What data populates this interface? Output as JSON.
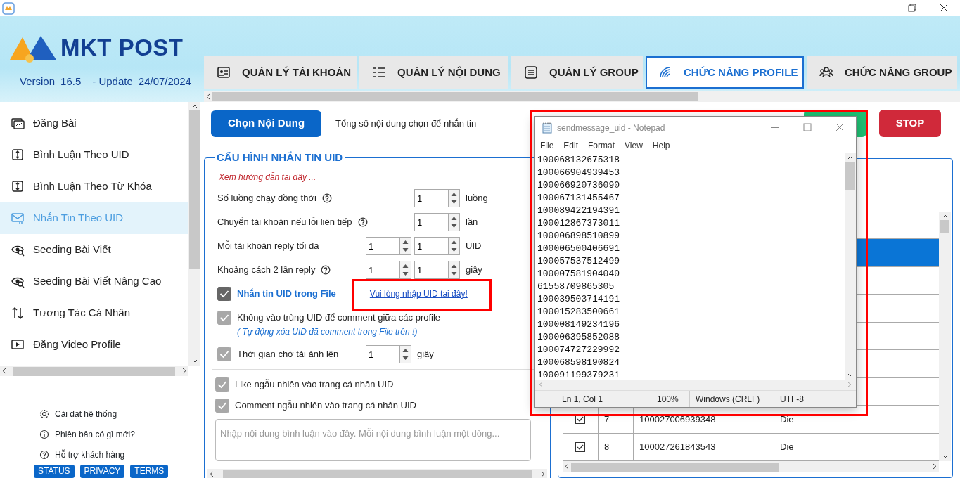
{
  "header": {
    "brand": "MKT POST",
    "version_label": "Version",
    "version": "16.5",
    "update_label": "- Update",
    "update_date": "24/07/2024"
  },
  "tabs": [
    {
      "label": "QUẢN LÝ TÀI KHOẢN",
      "selected": false
    },
    {
      "label": "QUẢN LÝ NỘI DUNG",
      "selected": false
    },
    {
      "label": "QUẢN LÝ GROUP",
      "selected": false
    },
    {
      "label": "CHỨC NĂNG PROFILE",
      "selected": true
    },
    {
      "label": "CHỨC NĂNG GROUP",
      "selected": false
    }
  ],
  "sidebar": {
    "items": [
      {
        "label": "Đăng Bài",
        "selected": false
      },
      {
        "label": "Bình Luận Theo UID",
        "selected": false
      },
      {
        "label": "Bình Luận Theo Từ Khóa",
        "selected": false
      },
      {
        "label": "Nhắn Tin Theo UID",
        "selected": true
      },
      {
        "label": "Seeding Bài Viết",
        "selected": false
      },
      {
        "label": "Seeding Bài Viết Nâng Cao",
        "selected": false
      },
      {
        "label": "Tương Tác Cá Nhân",
        "selected": false
      },
      {
        "label": "Đăng Video Profile",
        "selected": false
      }
    ],
    "links": [
      "Cài đặt hệ thống",
      "Phiên bản có gì mới?",
      "Hỗ trợ khách hàng"
    ],
    "footer_buttons": [
      "STATUS",
      "PRIVACY",
      "TERMS"
    ]
  },
  "toolbar": {
    "choose_button": "Chọn Nội Dung",
    "summary": "Tổng số nội dung chọn để nhắn tin",
    "stop_button": "STOP"
  },
  "config": {
    "title": "CẤU HÌNH NHẮN TIN UID",
    "guide_link": "Xem hướng dẫn tại đây ...",
    "settings": [
      {
        "label": "Số luồng chạy đồng thời",
        "help": true,
        "values": [
          "1"
        ],
        "unit": "luồng"
      },
      {
        "label": "Chuyển tài khoản nếu lỗi liên tiếp",
        "help": true,
        "values": [
          "1"
        ],
        "unit": "lần"
      },
      {
        "label": "Mỗi tài khoản reply tối đa",
        "help": false,
        "values": [
          "1",
          "1"
        ],
        "unit": "UID"
      },
      {
        "label": "Khoảng cách 2 lần reply",
        "help": true,
        "values": [
          "1",
          "1"
        ],
        "unit": "giây"
      }
    ],
    "options": [
      {
        "label": "Nhắn tin UID trong File",
        "checked": true,
        "disabled": false,
        "link": "Vui lòng nhập UID tai đây!"
      },
      {
        "label": "Không vào trùng UID để comment giữa các profile",
        "checked": true,
        "disabled": true,
        "note": "( Tự động xóa UID đã comment trong File trên !)"
      },
      {
        "label": "Thời gian chờ tải ảnh lên",
        "checked": true,
        "disabled": true,
        "values": [
          "1"
        ],
        "unit": "giây"
      }
    ],
    "profile_options": [
      {
        "label": "Like ngẫu nhiên vào trang cá nhân UID",
        "checked": true,
        "disabled": true
      },
      {
        "label": "Comment ngẫu nhiên vào trang cá nhân UID",
        "checked": true,
        "disabled": true
      }
    ],
    "comment_placeholder": "Nhập nội dung bình luận vào đây. Mỗi nội dung bình luận một dòng..."
  },
  "uid_table": {
    "rows": [
      {
        "selected": true
      },
      {
        "selected": false
      },
      {
        "selected": false
      },
      {
        "selected": false
      },
      {
        "selected": false
      },
      {
        "selected": false
      },
      {
        "selected": false,
        "checked": true,
        "number": "7",
        "uid": "100027006939348",
        "status": "Die"
      },
      {
        "selected": false,
        "checked": true,
        "number": "8",
        "uid": "100027261843543",
        "status": "Die"
      }
    ]
  },
  "notepad": {
    "title": "sendmessage_uid - Notepad",
    "menu": [
      "File",
      "Edit",
      "Format",
      "View",
      "Help"
    ],
    "lines": [
      "100068132675318",
      "100066904939453",
      "100066920736090",
      "100067131455467",
      "100089422194391",
      "100012867373011",
      "100006898510899",
      "100006500406691",
      "100057537512499",
      "100007581904040",
      "61558709865305",
      "100039503714191",
      "100015283500661",
      "100008149234196",
      "100006395852088",
      "100074727229992",
      "100068598190824",
      "100091199379231"
    ],
    "status": {
      "position": "Ln 1, Col 1",
      "zoom": "100%",
      "line_ending": "Windows (CRLF)",
      "encoding": "UTF-8"
    }
  }
}
